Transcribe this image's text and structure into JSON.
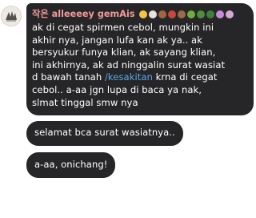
{
  "sender": {
    "name": "작은 alleeeey gemAis",
    "name_color": "#f39a99"
  },
  "emojis": [
    {
      "icon": "hatching-chick-icon",
      "color": "#f5c542"
    },
    {
      "icon": "chicken-icon",
      "color": "#e8e2dc"
    },
    {
      "icon": "bird-icon",
      "color": "#a0673c"
    },
    {
      "icon": "rooster-icon",
      "color": "#c9463b"
    },
    {
      "icon": "snail-icon",
      "color": "#9b6b4a"
    },
    {
      "icon": "dragon-icon",
      "color": "#6cae3f"
    },
    {
      "icon": "turtle-icon",
      "color": "#4f8e3a"
    },
    {
      "icon": "dinosaur-icon",
      "color": "#3f7f3b"
    },
    {
      "icon": "unicorn-icon",
      "color": "#c68ad9"
    },
    {
      "icon": "cat-icon",
      "color": "#d6a8d6"
    }
  ],
  "messages": {
    "main_before": "ak di cegat spirmen cebol, mungkin ini\nakhir nya, jangan lufa kan ak ya.. ak\nbersyukur funya klian, ak sayang klian,\nini akhirnya, ak ad ninggalin surat wasiat\nd bawah tanah ",
    "mention": "/kesakitan",
    "main_after": " krna di cegat\ncebol.. a-aa jgn lupa di baca ya nak,\nslmat tinggal smw nya",
    "second": "selamat bca surat wasiatnya..",
    "third": "a-aa, onichang!"
  },
  "colors": {
    "bubble_bg": "#262628",
    "text": "#ffffff",
    "mention": "#5aa6e8"
  }
}
